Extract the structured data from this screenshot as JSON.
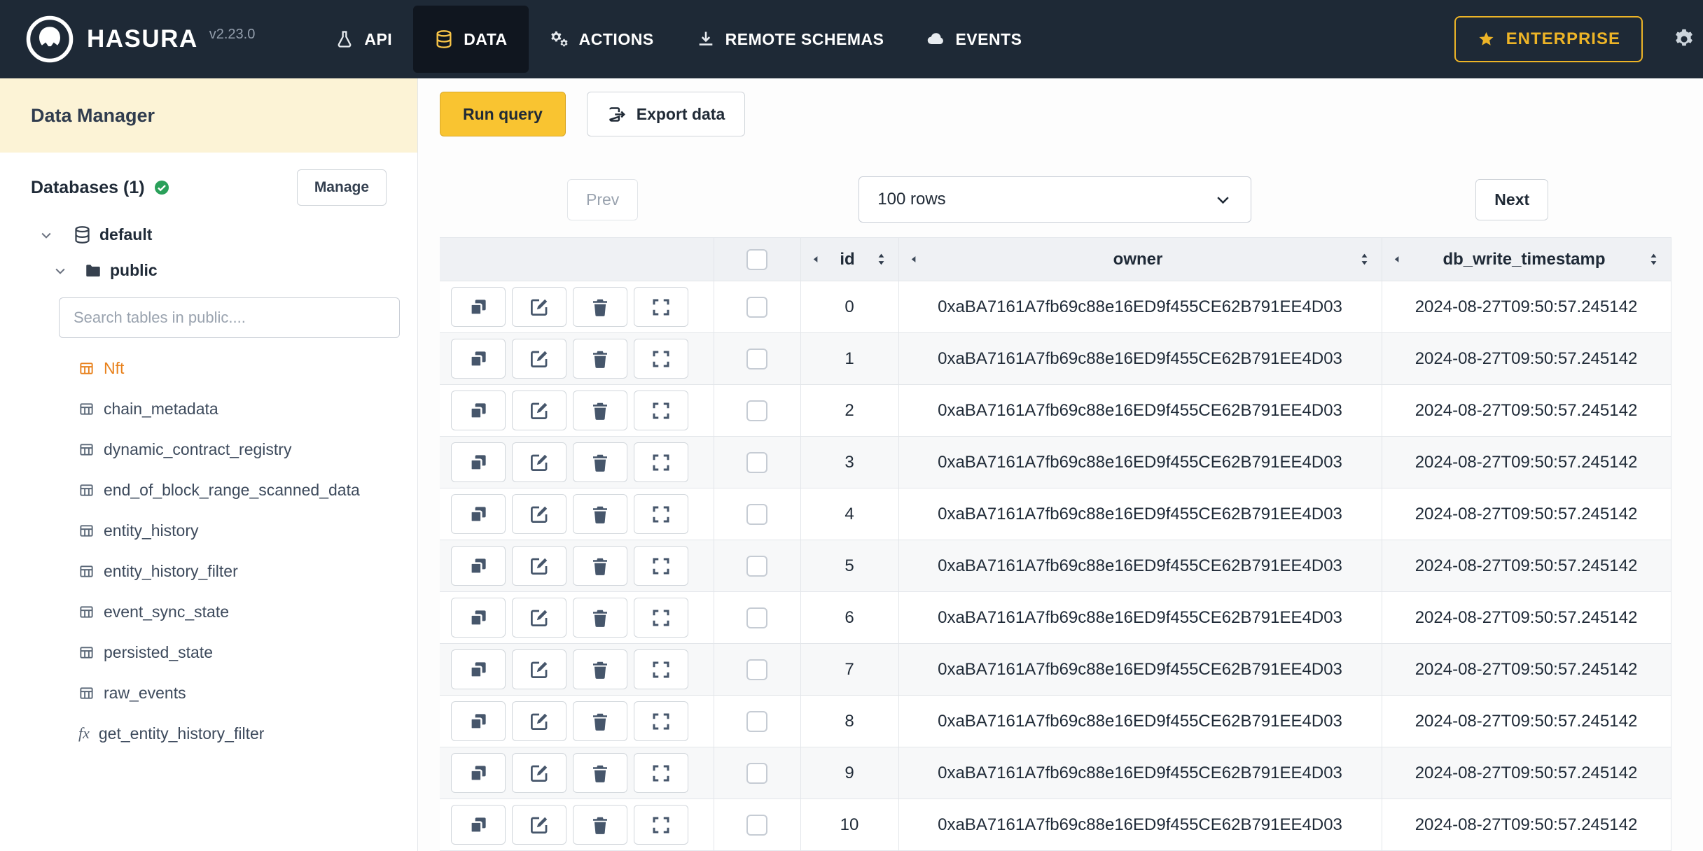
{
  "topbar": {
    "brand": "HASURA",
    "version": "v2.23.0",
    "nav": [
      {
        "label": "API",
        "icon": "flask-icon",
        "active": false
      },
      {
        "label": "DATA",
        "icon": "database-icon",
        "active": true
      },
      {
        "label": "ACTIONS",
        "icon": "gears-icon",
        "active": false
      },
      {
        "label": "REMOTE SCHEMAS",
        "icon": "download-icon",
        "active": false
      },
      {
        "label": "EVENTS",
        "icon": "cloud-icon",
        "active": false
      }
    ],
    "enterprise_label": "ENTERPRISE"
  },
  "sidebar": {
    "title": "Data Manager",
    "databases_label": "Databases (1)",
    "manage_label": "Manage",
    "tree": {
      "database": "default",
      "schema": "public",
      "search_placeholder": "Search tables in public....",
      "tables": [
        {
          "name": "Nft",
          "selected": true
        },
        {
          "name": "chain_metadata",
          "selected": false
        },
        {
          "name": "dynamic_contract_registry",
          "selected": false
        },
        {
          "name": "end_of_block_range_scanned_data",
          "selected": false
        },
        {
          "name": "entity_history",
          "selected": false
        },
        {
          "name": "entity_history_filter",
          "selected": false
        },
        {
          "name": "event_sync_state",
          "selected": false
        },
        {
          "name": "persisted_state",
          "selected": false
        },
        {
          "name": "raw_events",
          "selected": false
        }
      ],
      "function_name": "get_entity_history_filter"
    }
  },
  "toolbar": {
    "run_query_label": "Run query",
    "export_data_label": "Export data"
  },
  "pagination": {
    "prev_label": "Prev",
    "rows_value": "100 rows",
    "next_label": "Next"
  },
  "table": {
    "columns": [
      "id",
      "owner",
      "db_write_timestamp"
    ],
    "rows": [
      {
        "id": "0",
        "owner": "0xaBA7161A7fb69c88e16ED9f455CE62B791EE4D03",
        "db_write_timestamp": "2024-08-27T09:50:57.245142"
      },
      {
        "id": "1",
        "owner": "0xaBA7161A7fb69c88e16ED9f455CE62B791EE4D03",
        "db_write_timestamp": "2024-08-27T09:50:57.245142"
      },
      {
        "id": "2",
        "owner": "0xaBA7161A7fb69c88e16ED9f455CE62B791EE4D03",
        "db_write_timestamp": "2024-08-27T09:50:57.245142"
      },
      {
        "id": "3",
        "owner": "0xaBA7161A7fb69c88e16ED9f455CE62B791EE4D03",
        "db_write_timestamp": "2024-08-27T09:50:57.245142"
      },
      {
        "id": "4",
        "owner": "0xaBA7161A7fb69c88e16ED9f455CE62B791EE4D03",
        "db_write_timestamp": "2024-08-27T09:50:57.245142"
      },
      {
        "id": "5",
        "owner": "0xaBA7161A7fb69c88e16ED9f455CE62B791EE4D03",
        "db_write_timestamp": "2024-08-27T09:50:57.245142"
      },
      {
        "id": "6",
        "owner": "0xaBA7161A7fb69c88e16ED9f455CE62B791EE4D03",
        "db_write_timestamp": "2024-08-27T09:50:57.245142"
      },
      {
        "id": "7",
        "owner": "0xaBA7161A7fb69c88e16ED9f455CE62B791EE4D03",
        "db_write_timestamp": "2024-08-27T09:50:57.245142"
      },
      {
        "id": "8",
        "owner": "0xaBA7161A7fb69c88e16ED9f455CE62B791EE4D03",
        "db_write_timestamp": "2024-08-27T09:50:57.245142"
      },
      {
        "id": "9",
        "owner": "0xaBA7161A7fb69c88e16ED9f455CE62B791EE4D03",
        "db_write_timestamp": "2024-08-27T09:50:57.245142"
      },
      {
        "id": "10",
        "owner": "0xaBA7161A7fb69c88e16ED9f455CE62B791EE4D03",
        "db_write_timestamp": "2024-08-27T09:50:57.245142"
      }
    ]
  },
  "colors": {
    "topbar_bg": "#1e2936",
    "active_tab_bg": "#10161f",
    "accent_amber": "#f9c431",
    "enterprise_yellow": "#edb427",
    "selected_table_orange": "#e8811c",
    "sidebar_header_cream": "#fcf3d6",
    "check_green": "#2aa05a",
    "text_dark": "#1f2a37"
  }
}
